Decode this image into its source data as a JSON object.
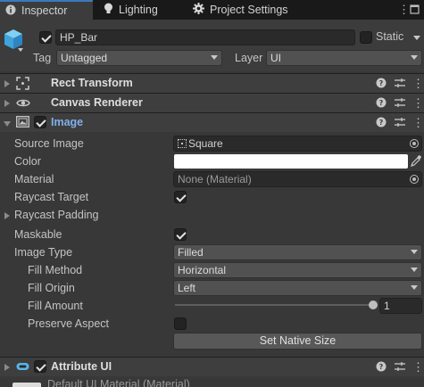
{
  "tabs": [
    {
      "label": "Inspector",
      "icon": "info-icon"
    },
    {
      "label": "Lighting",
      "icon": "lightbulb-icon"
    },
    {
      "label": "Project Settings",
      "icon": "gear-icon"
    }
  ],
  "object": {
    "name": "HP_Bar",
    "active": true,
    "static_label": "Static",
    "tag_label": "Tag",
    "tag_value": "Untagged",
    "layer_label": "Layer",
    "layer_value": "UI"
  },
  "components": {
    "rect_transform": {
      "title": "Rect Transform",
      "icon": "rect-transform-icon"
    },
    "canvas_renderer": {
      "title": "Canvas Renderer",
      "icon": "eye-icon"
    },
    "image": {
      "title": "Image",
      "icon": "image-icon",
      "enabled": true
    },
    "attribute_ui": {
      "title": "Attribute UI",
      "icon": "script-icon",
      "enabled": true
    }
  },
  "image_props": {
    "source_image_label": "Source Image",
    "source_image_value": "Square",
    "color_label": "Color",
    "color_value": "#ffffff",
    "material_label": "Material",
    "material_value": "None (Material)",
    "raycast_target_label": "Raycast Target",
    "raycast_target": true,
    "raycast_padding_label": "Raycast Padding",
    "maskable_label": "Maskable",
    "maskable": true,
    "image_type_label": "Image Type",
    "image_type_value": "Filled",
    "fill_method_label": "Fill Method",
    "fill_method_value": "Horizontal",
    "fill_origin_label": "Fill Origin",
    "fill_origin_value": "Left",
    "fill_amount_label": "Fill Amount",
    "fill_amount_value": "1",
    "fill_amount": 1,
    "preserve_aspect_label": "Preserve Aspect",
    "preserve_aspect": false,
    "set_native_size_label": "Set Native Size"
  },
  "next_row": {
    "material_value": "Default UI Material (Material)"
  }
}
